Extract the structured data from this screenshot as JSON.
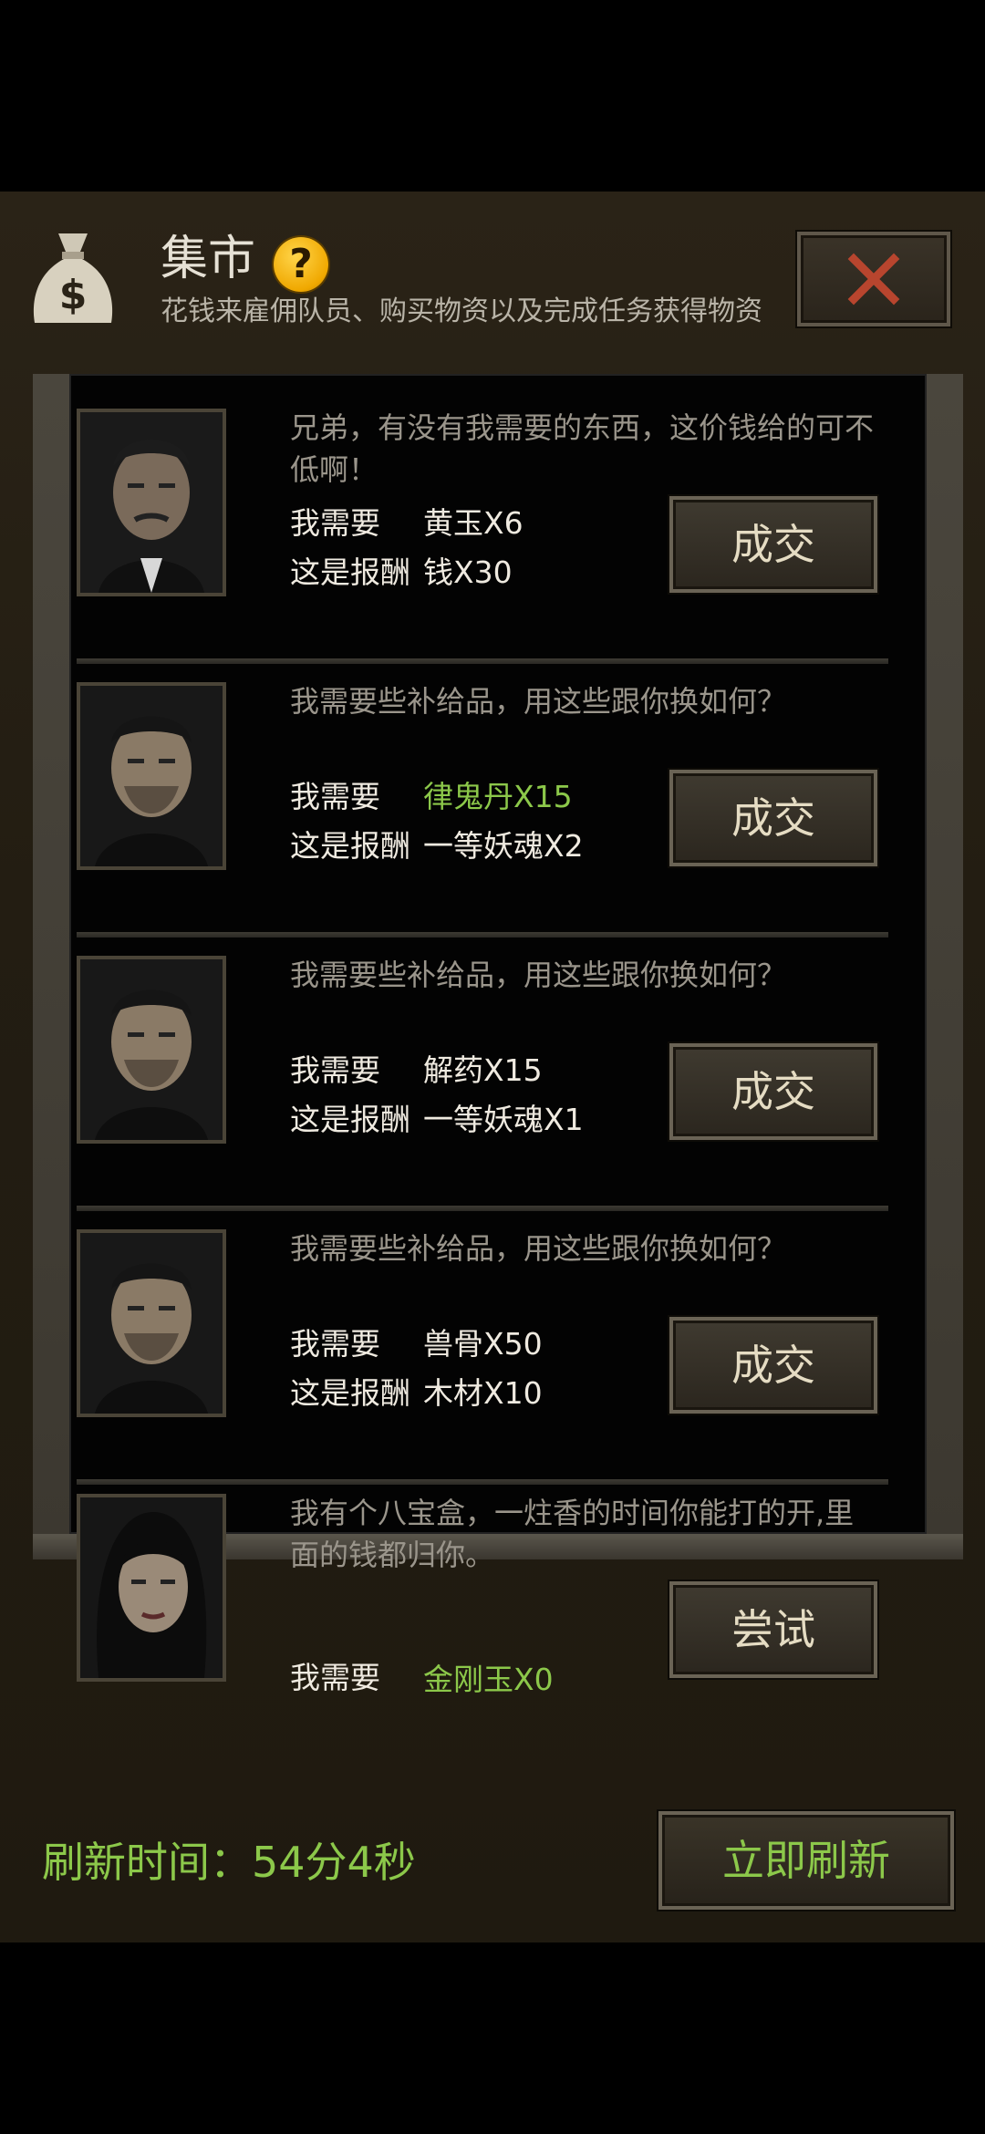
{
  "header": {
    "title": "集市",
    "help_icon": "question-mark-icon",
    "help_glyph": "?",
    "subtitle": "花钱来雇佣队员、购买物资以及完成任务获得物资",
    "money_bag_icon": "money-bag-icon",
    "money_bag_glyph": "$",
    "close_icon": "close-icon"
  },
  "labels": {
    "need": "我需要",
    "reward": "这是报酬"
  },
  "offers": [
    {
      "message": "兄弟，有没有我需要的东西，这价钱给的可不低啊！",
      "need": "黄玉X6",
      "need_highlight": false,
      "reward": "钱X30",
      "button": "成交",
      "portrait": "portrait-man-mustache"
    },
    {
      "message": "我需要些补给品，用这些跟你换如何？",
      "need": "律鬼丹X15",
      "need_highlight": true,
      "reward": "一等妖魂X2",
      "button": "成交",
      "portrait": "portrait-man-stubble"
    },
    {
      "message": "我需要些补给品，用这些跟你换如何？",
      "need": "解药X15",
      "need_highlight": false,
      "reward": "一等妖魂X1",
      "button": "成交",
      "portrait": "portrait-man-stubble"
    },
    {
      "message": "我需要些补给品，用这些跟你换如何？",
      "need": "兽骨X50",
      "need_highlight": false,
      "reward": "木材X10",
      "button": "成交",
      "portrait": "portrait-man-stubble"
    },
    {
      "message": "我有个八宝盒，一炷香的时间你能打的开,里面的钱都归你。",
      "need": "金刚玉X0",
      "need_highlight": true,
      "reward": null,
      "button": "尝试",
      "portrait": "portrait-woman"
    }
  ],
  "footer": {
    "refresh_text": "刷新时间：54分4秒",
    "refresh_button": "立即刷新"
  },
  "colors": {
    "highlight_green": "#8cc84a",
    "text_light": "#efeae0",
    "text_muted": "#9a958b",
    "help_yellow": "#f0a800"
  }
}
